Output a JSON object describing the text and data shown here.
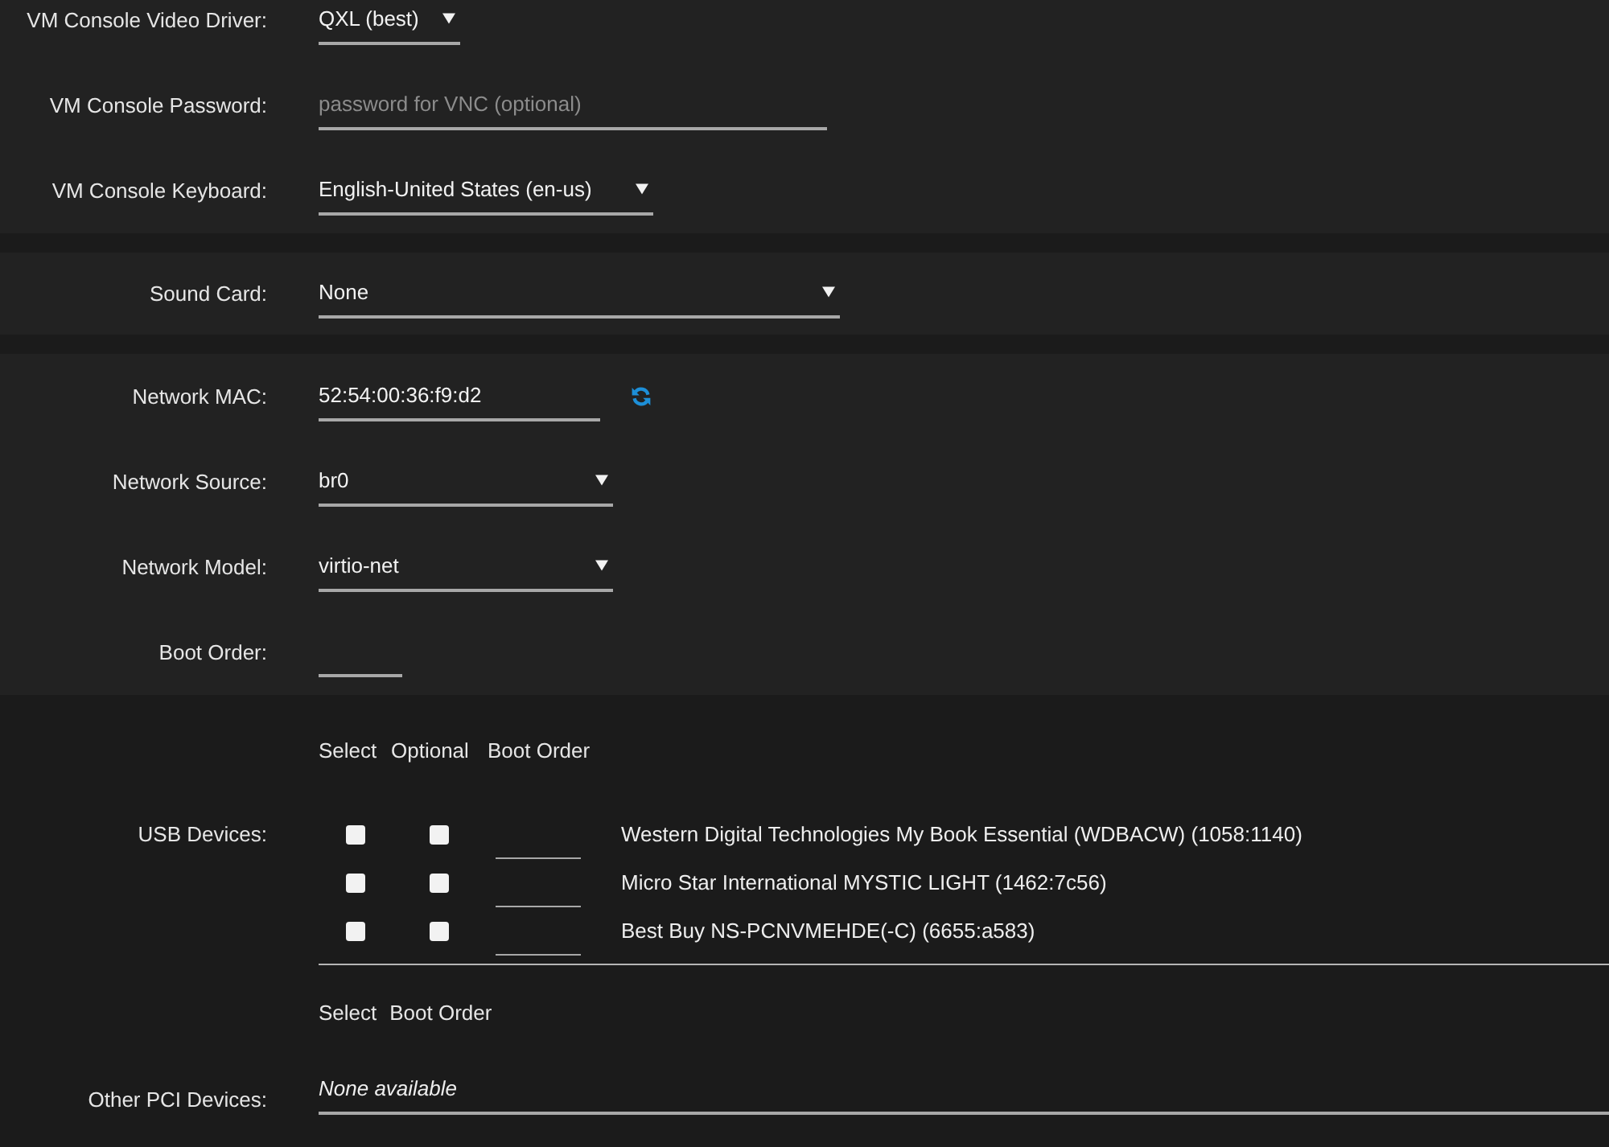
{
  "sections": [
    {
      "fields": [
        {
          "kind": "select",
          "label": "VM Console Video Driver:",
          "value": "QXL (best)"
        },
        {
          "kind": "input",
          "label": "VM Console Password:",
          "placeholder": "password for VNC (optional)"
        },
        {
          "kind": "select",
          "label": "VM Console Keyboard:",
          "value": "English-United States (en-us)"
        }
      ]
    },
    {
      "fields": [
        {
          "kind": "select",
          "label": "Sound Card:",
          "value": "None"
        }
      ]
    },
    {
      "fields": [
        {
          "kind": "refreshable",
          "label": "Network MAC:",
          "value": "52:54:00:36:f9:d2"
        },
        {
          "kind": "select",
          "label": "Network Source:",
          "value": "br0"
        },
        {
          "kind": "select",
          "label": "Network Model:",
          "value": "virtio-net"
        },
        {
          "kind": "input",
          "label": "Boot Order:"
        }
      ]
    }
  ],
  "usb_devices": {
    "label": "USB Devices:",
    "columns": [
      "Select",
      "Optional",
      "Boot Order"
    ],
    "devices": [
      {
        "name": "Western Digital Technologies My Book Essential (WDBACW) (1058:1140)",
        "selected": false,
        "optional": false
      },
      {
        "name": "Micro Star International MYSTIC LIGHT (1462:7c56)",
        "selected": false,
        "optional": false
      },
      {
        "name": "Best Buy NS-PCNVMEHDE(-C) (6655:a583)",
        "selected": false,
        "optional": false
      }
    ]
  },
  "pci_devices": {
    "label": "Other PCI Devices:",
    "columns": [
      "Select",
      "Boot Order"
    ],
    "value": "None available"
  }
}
